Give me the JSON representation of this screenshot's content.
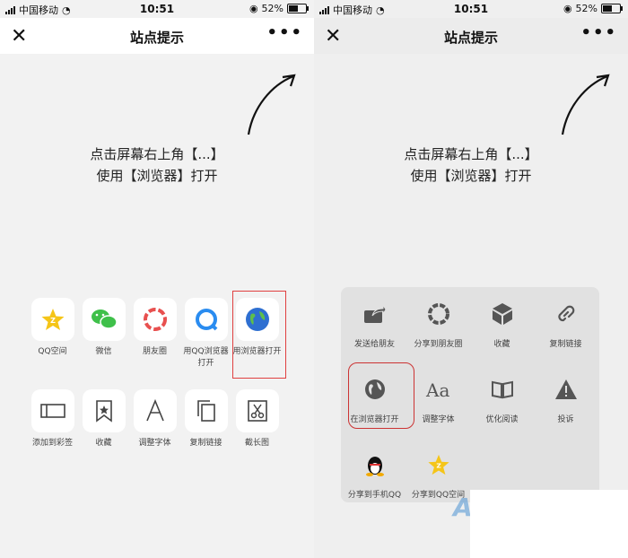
{
  "status_bar": {
    "carrier": "中国移动",
    "time": "10:51",
    "battery": "52%"
  },
  "nav": {
    "title": "站点提示"
  },
  "hint": {
    "line1": "点击屏幕右上角【...】",
    "line2": "使用【浏览器】打开"
  },
  "left_grid": [
    {
      "label": "QQ空间"
    },
    {
      "label": "微信"
    },
    {
      "label": "朋友圈"
    },
    {
      "label": "用QQ浏览器打开"
    },
    {
      "label": "用浏览器打开"
    },
    {
      "label": "添加到彩签"
    },
    {
      "label": "收藏"
    },
    {
      "label": "调整字体"
    },
    {
      "label": "复制链接"
    },
    {
      "label": "截长图"
    }
  ],
  "right_sheet": [
    {
      "label": "发送给朋友"
    },
    {
      "label": "分享到朋友圈"
    },
    {
      "label": "收藏"
    },
    {
      "label": "复制链接"
    },
    {
      "label": "在浏览器打开"
    },
    {
      "label": "调整字体"
    },
    {
      "label": "优化阅读"
    },
    {
      "label": "投诉"
    },
    {
      "label": "分享到手机QQ"
    },
    {
      "label": "分享到QQ空间"
    }
  ],
  "colors": {
    "highlight": "#e04040",
    "wechat_green": "#3fc04a",
    "qzone_yellow": "#f5c518"
  }
}
